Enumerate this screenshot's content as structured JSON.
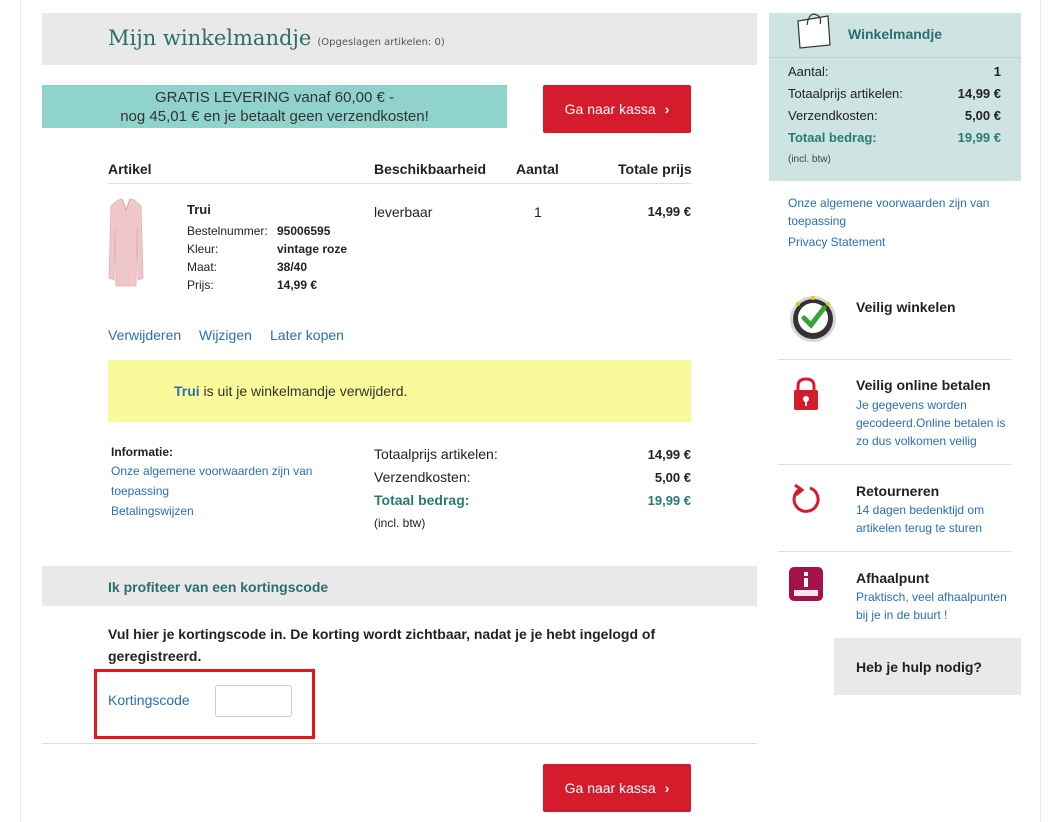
{
  "page": {
    "title": "Mijn winkelmandje",
    "saved_items": "(Opgeslagen artikelen: 0)"
  },
  "banner": {
    "line1": "GRATIS LEVERING vanaf 60,00 € -",
    "line2": "nog 45,01 € en je betaalt geen verzendkosten!"
  },
  "checkout_button": "Ga naar kassa",
  "table": {
    "headers": [
      "Artikel",
      "Beschikbaarheid",
      "Aantal",
      "Totale prijs"
    ]
  },
  "item": {
    "name": "Trui",
    "details": [
      {
        "label": "Bestelnummer:",
        "value": "95006595"
      },
      {
        "label": "Kleur:",
        "value": "vintage roze"
      },
      {
        "label": "Maat:",
        "value": "38/40"
      },
      {
        "label": "Prijs:",
        "value": "14,99 €"
      }
    ],
    "availability": "leverbaar",
    "quantity": "1",
    "total": "14,99 €",
    "color_hex": "#f0c7c9"
  },
  "item_actions": [
    "Verwijderen",
    "Wijzigen",
    "Later kopen"
  ],
  "notice": {
    "item": "Trui",
    "text": " is uit je winkelmandje verwijderd."
  },
  "info": {
    "title": "Informatie:",
    "links": [
      "Onze algemene voorwaarden zijn van toepassing",
      "Betalingswijzen"
    ]
  },
  "summary": {
    "subtotal_label": "Totaalprijs artikelen:",
    "subtotal": "14,99 €",
    "shipping_label": "Verzendkosten:",
    "shipping": "5,00 €",
    "total_label": "Totaal bedrag:",
    "total": "19,99 €",
    "vat": "(incl. btw)"
  },
  "discount": {
    "heading": "Ik profiteer van een kortingscode",
    "text": "Vul hier je kortingscode in. De korting wordt zichtbaar, nadat je je hebt ingelogd of geregistreerd.",
    "label": "Kortingscode",
    "value": ""
  },
  "sidebar": {
    "cart_title": "Winkelmandje",
    "rows": [
      {
        "label": "Aantal:",
        "value": "1"
      },
      {
        "label": "Totaalprijs artikelen:",
        "value": "14,99 €"
      },
      {
        "label": "Verzendkosten:",
        "value": "5,00 €"
      },
      {
        "label": "Totaal bedrag:",
        "value": "19,99 €"
      }
    ],
    "vat": "(incl. btw)",
    "terms_link": "Onze algemene voorwaarden zijn van toepassing",
    "privacy_link": "Privacy Statement",
    "features": [
      {
        "title": "Veilig winkelen",
        "desc": "",
        "icon": "safe-shopping-seal-icon"
      },
      {
        "title": "Veilig online betalen",
        "desc": "Je gegevens worden gecodeerd.Online betalen is zo dus volkomen veilig",
        "icon": "lock-icon"
      },
      {
        "title": "Retourneren",
        "desc": "14 dagen bedenktijd om artikelen terug te sturen",
        "icon": "return-arrow-icon"
      },
      {
        "title": "Afhaalpunt",
        "desc": "Praktisch, veel afhaalpunten bij je in de buurt !",
        "icon": "mondial-relay-icon"
      }
    ],
    "help": "Heb je hulp nodig?"
  },
  "colors": {
    "accent_red": "#d41c2c",
    "teal": "#2a6f6b",
    "link_blue": "#2a6fb3",
    "banner_teal": "#8fd3cc",
    "notice_yellow": "#fafa9a",
    "sidebar_panel": "#cde4e3"
  }
}
